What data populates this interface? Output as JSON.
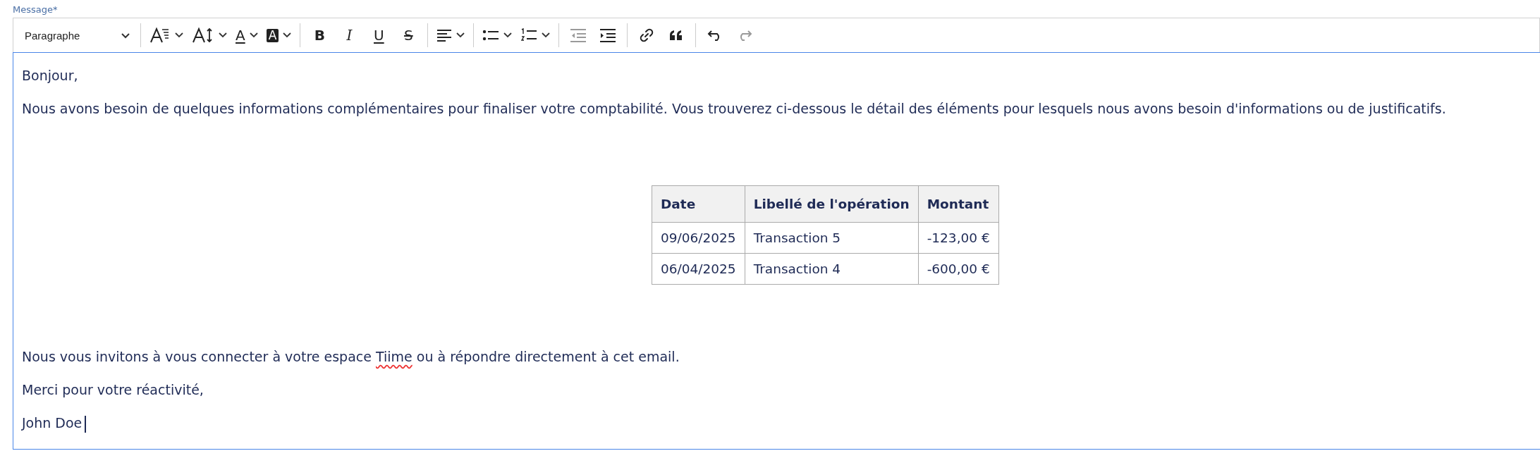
{
  "field_label": "Message*",
  "toolbar": {
    "block_format": "Paragraphe",
    "tools": [
      {
        "kind": "font-family",
        "disabled": false
      },
      {
        "kind": "font-size",
        "disabled": false
      },
      {
        "kind": "font-color",
        "glyph": "A",
        "disabled": false
      },
      {
        "kind": "highlight",
        "glyph": "A",
        "disabled": false
      },
      {
        "kind": "bold",
        "glyph": "B",
        "disabled": false
      },
      {
        "kind": "italic",
        "glyph": "I",
        "disabled": false
      },
      {
        "kind": "underline",
        "glyph": "U",
        "disabled": false
      },
      {
        "kind": "strike",
        "glyph": "S",
        "disabled": false
      },
      {
        "kind": "align",
        "disabled": false
      },
      {
        "kind": "bullet-list",
        "disabled": false
      },
      {
        "kind": "numbered-list",
        "disabled": false
      },
      {
        "kind": "outdent",
        "disabled": true
      },
      {
        "kind": "indent",
        "disabled": false
      },
      {
        "kind": "link",
        "disabled": false
      },
      {
        "kind": "quote",
        "disabled": false
      },
      {
        "kind": "undo",
        "disabled": false
      },
      {
        "kind": "redo",
        "disabled": true
      }
    ]
  },
  "editor": {
    "before": [
      {
        "parts": [
          {
            "text": "Bonjour,",
            "misspelled": false
          }
        ]
      },
      {
        "parts": [
          {
            "text": "Nous avons besoin de quelques informations complémentaires pour finaliser votre comptabilité. Vous trouverez ci-dessous le détail des éléments pour lesquels nous avons besoin d'informations ou de justificatifs.",
            "misspelled": false
          }
        ]
      }
    ],
    "table": {
      "columns": [
        "Date",
        "Libellé de l'opération",
        "Montant"
      ],
      "rows": [
        [
          "09/06/2025",
          "Transaction 5",
          "-123,00 €"
        ],
        [
          "06/04/2025",
          "Transaction 4",
          "-600,00 €"
        ]
      ]
    },
    "after": [
      {
        "parts": [
          {
            "text": "Nous vous invitons à vous connecter à votre espace ",
            "misspelled": false
          },
          {
            "text": "Tiime",
            "misspelled": true
          },
          {
            "text": " ou à répondre directement à cet email.",
            "misspelled": false
          }
        ]
      },
      {
        "parts": [
          {
            "text": "Merci pour votre réactivité,",
            "misspelled": false
          }
        ]
      },
      {
        "parts": [
          {
            "text": "John Doe",
            "misspelled": false
          }
        ]
      }
    ],
    "caret_after_last": true
  }
}
